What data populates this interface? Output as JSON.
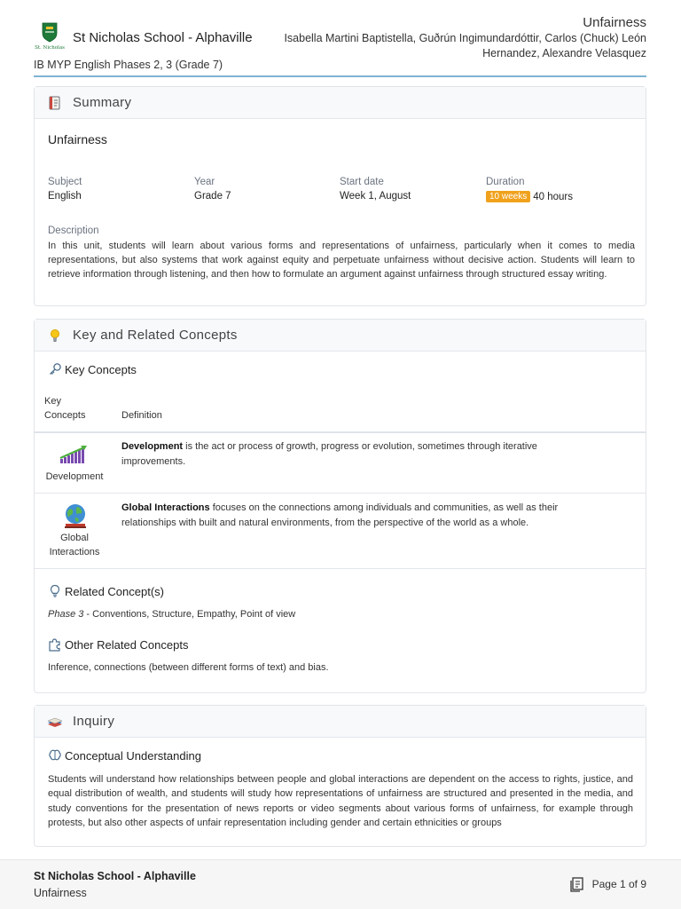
{
  "header": {
    "school_name": "St Nicholas School - Alphaville",
    "logo_text": "St. Nicholas",
    "doc_title": "Unfairness",
    "authors": "Isabella Martini Baptistella, Guðrún Ingimundardóttir, Carlos (Chuck) León Hernandez, Alexandre Velasquez",
    "course": "IB MYP English Phases 2, 3 (Grade 7)"
  },
  "summary": {
    "heading": "Summary",
    "icon": "book-icon",
    "unit_title": "Unfairness",
    "fields": [
      {
        "label": "Subject",
        "value": "English"
      },
      {
        "label": "Year",
        "value": "Grade 7"
      },
      {
        "label": "Start date",
        "value": "Week 1, August"
      },
      {
        "label": "Duration",
        "badge": "10 weeks",
        "value": "40 hours"
      }
    ],
    "description_label": "Description",
    "description": "In this unit, students will learn about various forms and representations of unfairness, particularly when it comes to media representations, but also systems that work against equity and perpetuate unfairness without decisive action. Students will learn to retrieve information through listening, and then how to formulate an argument against unfairness through structured essay writing."
  },
  "concepts": {
    "heading": "Key and Related Concepts",
    "icon": "lightbulb-icon",
    "key_concepts_heading": "Key Concepts",
    "col_key": "Key\nConcepts",
    "col_definition": "Definition",
    "rows": [
      {
        "name": "Development",
        "term": "Development",
        "definition": " is the act or process of growth, progress or evolution, sometimes through iterative improvements."
      },
      {
        "name": "Global\nInteractions",
        "term": "Global Interactions",
        "definition": " focuses on the connections among individuals and communities, as well as their relationships with built and natural environments, from the perspective of the world as a whole."
      }
    ],
    "related_heading": "Related Concept(s)",
    "related_phase": "Phase 3",
    "related_text": " - Conventions, Structure, Empathy, Point of view",
    "other_heading": "Other Related Concepts",
    "other_text": "Inference, connections (between different forms of text) and bias."
  },
  "inquiry": {
    "heading": "Inquiry",
    "icon": "books-icon",
    "conceptual_heading": "Conceptual Understanding",
    "text": "Students will understand how relationships between people and global interactions are dependent on the access to rights, justice, and equal distribution of wealth, and students will study how representations of unfairness are structured and presented in the media, and study conventions for the presentation of news reports or video segments about various forms of unfairness, for example through protests, but also other aspects of unfair representation including gender and certain ethnicities or groups"
  },
  "footer": {
    "school": "St Nicholas School - Alphaville",
    "title": "Unfairness",
    "page": "Page 1 of 9"
  },
  "colors": {
    "accent_rule": "#7fb4d3",
    "badge": "#f0a21d",
    "logo_green": "#1f7a3a"
  }
}
